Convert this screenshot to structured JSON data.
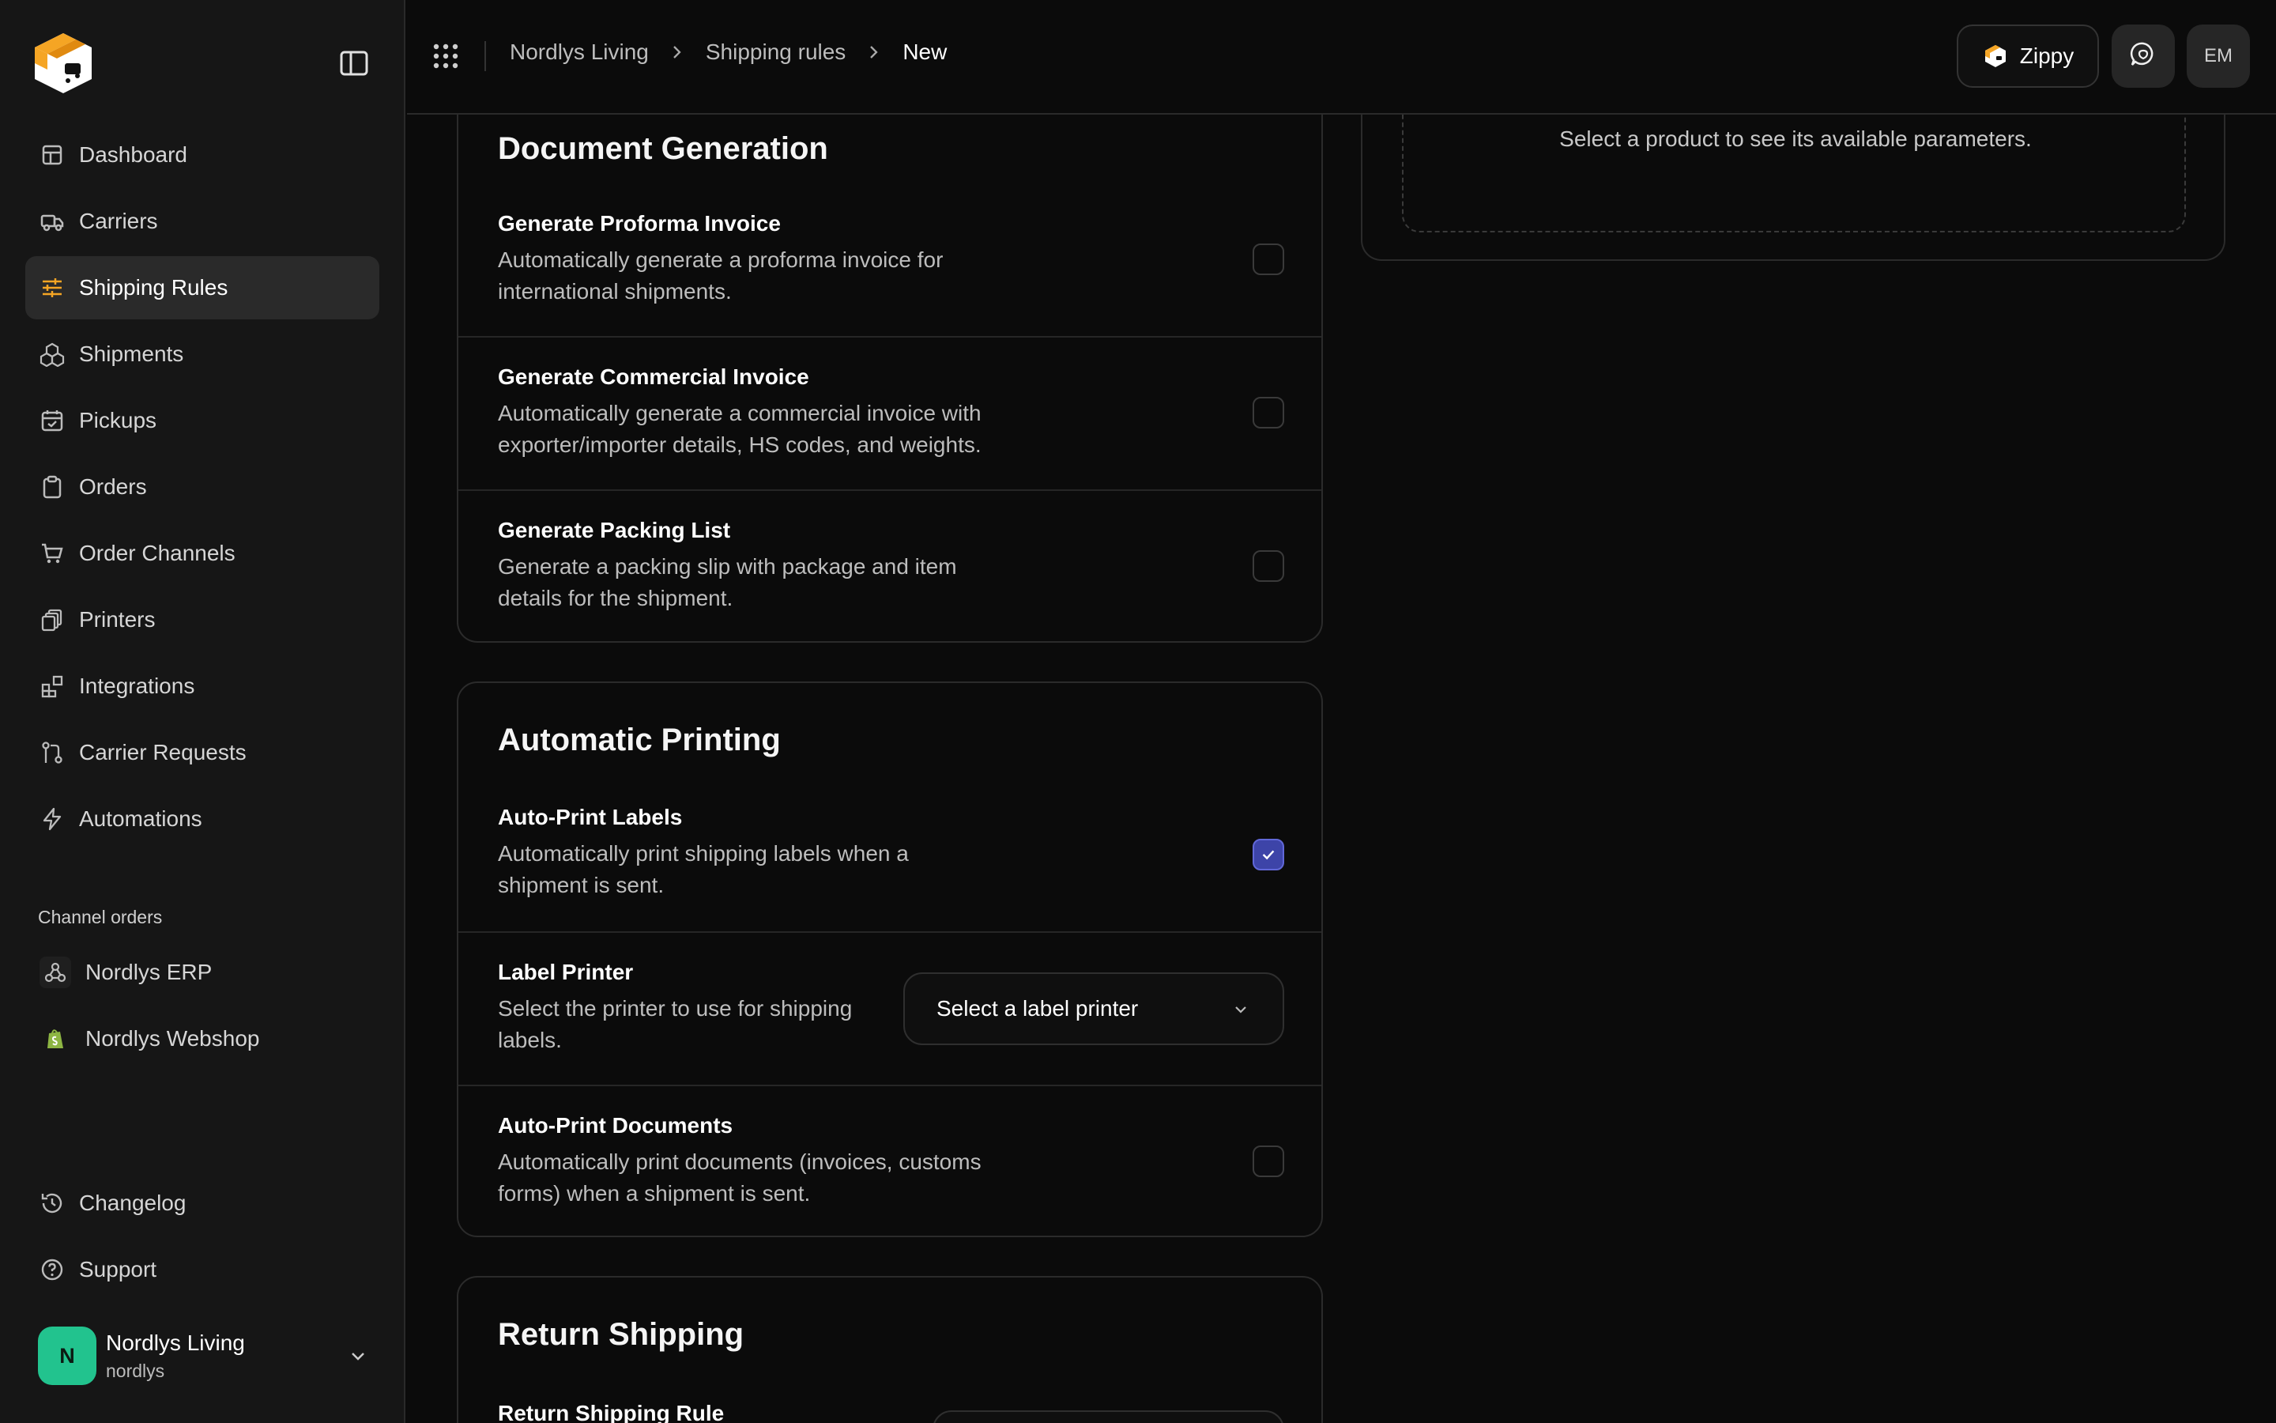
{
  "sidebar": {
    "items": [
      {
        "label": "Dashboard",
        "icon": "dashboard-icon",
        "active": false
      },
      {
        "label": "Carriers",
        "icon": "truck-icon",
        "active": false
      },
      {
        "label": "Shipping Rules",
        "icon": "sliders-icon",
        "active": true
      },
      {
        "label": "Shipments",
        "icon": "boxes-icon",
        "active": false
      },
      {
        "label": "Pickups",
        "icon": "calendar-check-icon",
        "active": false
      },
      {
        "label": "Orders",
        "icon": "clipboard-icon",
        "active": false
      },
      {
        "label": "Order Channels",
        "icon": "cart-icon",
        "active": false
      },
      {
        "label": "Printers",
        "icon": "printer-icon",
        "active": false
      },
      {
        "label": "Integrations",
        "icon": "blocks-icon",
        "active": false
      },
      {
        "label": "Carrier Requests",
        "icon": "git-pull-icon",
        "active": false
      },
      {
        "label": "Automations",
        "icon": "bolt-icon",
        "active": false
      }
    ],
    "channel_section_label": "Channel orders",
    "channels": [
      {
        "label": "Nordlys ERP",
        "icon": "webhook-icon"
      },
      {
        "label": "Nordlys Webshop",
        "icon": "shopify-icon"
      }
    ],
    "bottom": [
      {
        "label": "Changelog",
        "icon": "history-icon"
      },
      {
        "label": "Support",
        "icon": "help-circle-icon"
      }
    ],
    "account": {
      "initial": "N",
      "name": "Nordlys Living",
      "slug": "nordlys"
    }
  },
  "topbar": {
    "breadcrumbs": [
      "Nordlys Living",
      "Shipping rules",
      "New"
    ],
    "zippy_label": "Zippy",
    "user_initials": "EM"
  },
  "document_generation": {
    "title": "Document Generation",
    "rows": [
      {
        "title": "Generate Proforma Invoice",
        "desc": "Automatically generate a proforma invoice for international shipments.",
        "checked": false
      },
      {
        "title": "Generate Commercial Invoice",
        "desc": "Automatically generate a commercial invoice with exporter/importer details, HS codes, and weights.",
        "checked": false
      },
      {
        "title": "Generate Packing List",
        "desc": "Generate a packing slip with package and item details for the shipment.",
        "checked": false
      }
    ]
  },
  "automatic_printing": {
    "title": "Automatic Printing",
    "auto_print_labels": {
      "title": "Auto-Print Labels",
      "desc": "Automatically print shipping labels when a shipment is sent.",
      "checked": true
    },
    "label_printer": {
      "title": "Label Printer",
      "desc": "Select the printer to use for shipping labels.",
      "select_placeholder": "Select a label printer"
    },
    "auto_print_documents": {
      "title": "Auto-Print Documents",
      "desc": "Automatically print documents (invoices, customs forms) when a shipment is sent.",
      "checked": false
    }
  },
  "return_shipping": {
    "title": "Return Shipping",
    "row_title": "Return Shipping Rule"
  },
  "parameters_panel": {
    "hint": "Select a product to see its available parameters."
  },
  "colors": {
    "accent_orange": "#f5a524",
    "checkbox_checked": "#3d44a8",
    "avatar_green": "#22c38e"
  }
}
